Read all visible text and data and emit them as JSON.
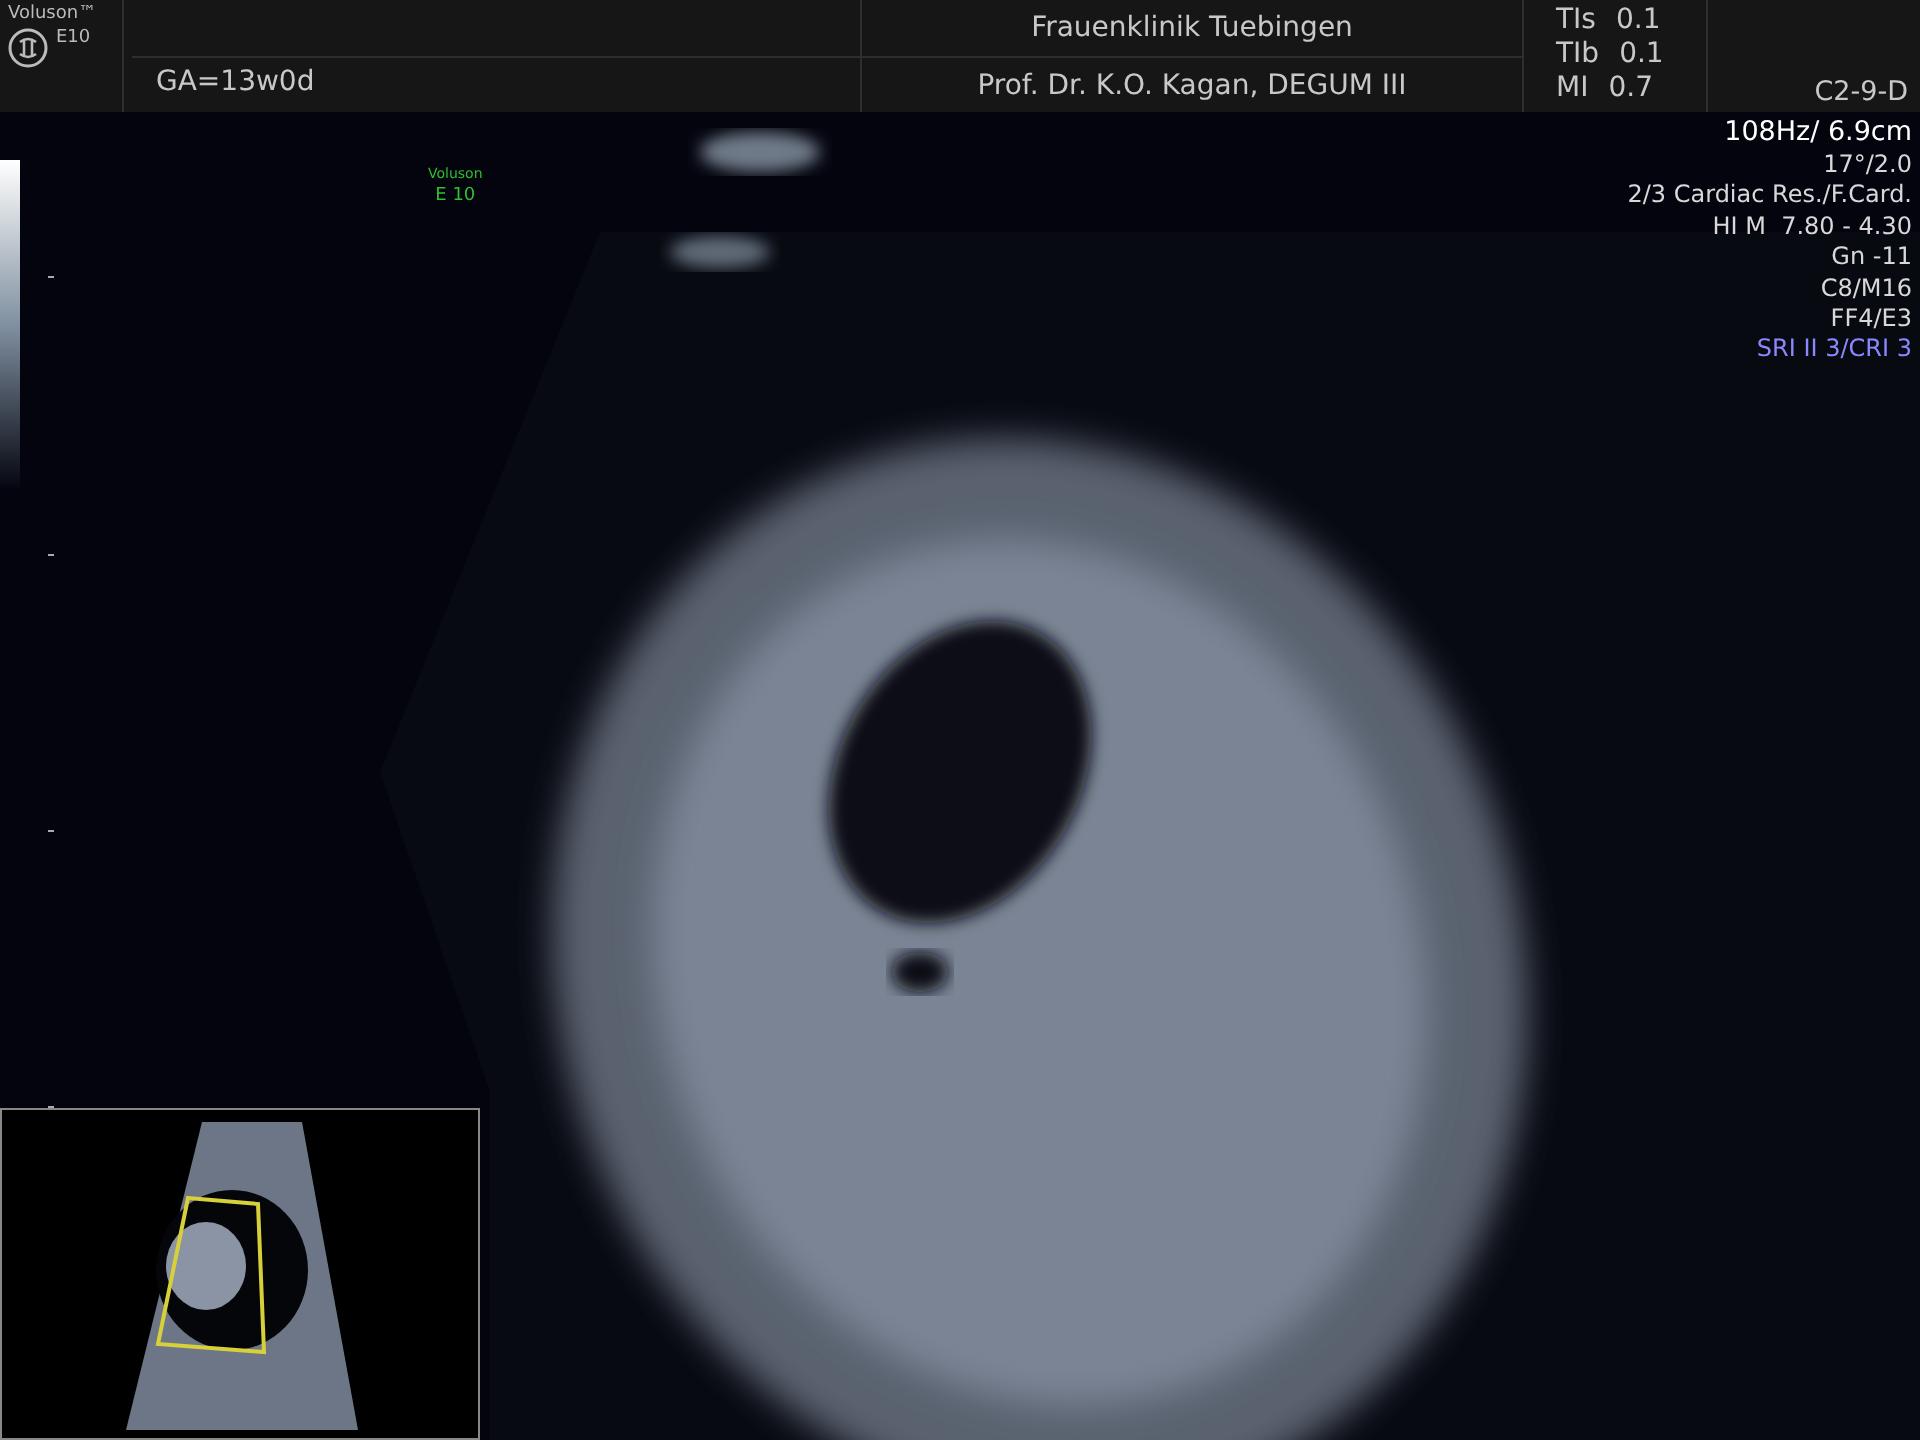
{
  "header": {
    "brand": "Voluson™",
    "model": "E10",
    "ga": "GA=13w0d",
    "clinic": "Frauenklinik Tuebingen",
    "physician": "Prof. Dr. K.O. Kagan, DEGUM III",
    "indices": [
      {
        "label": "TIs",
        "value": "0.1"
      },
      {
        "label": "TIb",
        "value": "0.1"
      },
      {
        "label": "MI",
        "value": "0.7"
      }
    ],
    "probe": "C2-9-D"
  },
  "image_brand": {
    "line1": "Voluson",
    "line2": "E 10"
  },
  "parameters": [
    {
      "text": "108Hz/ 6.9cm",
      "kind": "primary"
    },
    {
      "text": "17°/2.0",
      "kind": "normal"
    },
    {
      "text": "2/3 Cardiac Res./F.Card.",
      "kind": "normal"
    },
    {
      "text": "HI M  7.80 - 4.30",
      "kind": "normal"
    },
    {
      "text": "Gn -11",
      "kind": "normal"
    },
    {
      "text": "C8/M16",
      "kind": "normal"
    },
    {
      "text": "FF4/E3",
      "kind": "normal"
    },
    {
      "text": "SRI II 3/CRI 3",
      "kind": "highlight"
    }
  ]
}
